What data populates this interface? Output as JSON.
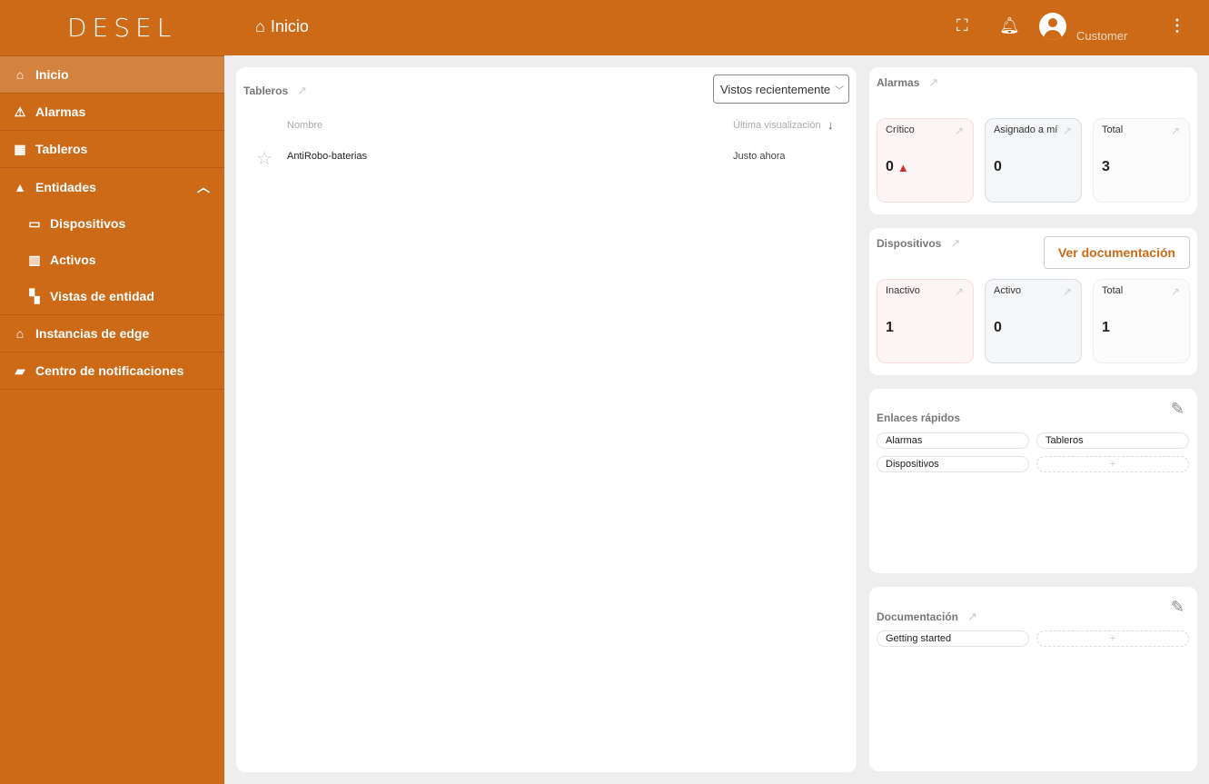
{
  "header": {
    "logo": "DESEL",
    "title": "Inicio",
    "user": "Customer"
  },
  "sidebar": {
    "items": [
      {
        "label": "Inicio",
        "icon": "home-icon"
      },
      {
        "label": "Alarmas",
        "icon": "warning-icon"
      },
      {
        "label": "Tableros",
        "icon": "dashboard-icon"
      },
      {
        "label": "Entidades",
        "icon": "shapes-icon"
      },
      {
        "label": "Dispositivos",
        "icon": "devices-icon"
      },
      {
        "label": "Activos",
        "icon": "domain-icon"
      },
      {
        "label": "Vistas de entidad",
        "icon": "view-quilt-icon"
      },
      {
        "label": "Instancias de edge",
        "icon": "router-icon"
      },
      {
        "label": "Centro de notificaciones",
        "icon": "notification-icon"
      }
    ]
  },
  "dashboards": {
    "title": "Tableros",
    "filter": "Vistos recientemente",
    "col_name": "Nombre",
    "col_last": "Última visualización",
    "rows": [
      {
        "name": "AntiRobo-baterias",
        "last": "Justo ahora"
      }
    ]
  },
  "alarms": {
    "title": "Alarmas",
    "stats": [
      {
        "label": "Crítico",
        "value": "0"
      },
      {
        "label": "Asignado a mí",
        "value": "0"
      },
      {
        "label": "Total",
        "value": "3"
      }
    ]
  },
  "devices": {
    "title": "Dispositivos",
    "button": "Ver documentación",
    "stats": [
      {
        "label": "Inactivo",
        "value": "1"
      },
      {
        "label": "Activo",
        "value": "0"
      },
      {
        "label": "Total",
        "value": "1"
      }
    ]
  },
  "quick_links": {
    "title": "Enlaces rápidos",
    "links": [
      "Alarmas",
      "Tableros",
      "Dispositivos"
    ],
    "add": "+"
  },
  "docs": {
    "title": "Documentación",
    "links": [
      "Getting started"
    ],
    "add": "+"
  },
  "colors": {
    "brand": "#cc6a18",
    "critical": "#d32f2f"
  }
}
